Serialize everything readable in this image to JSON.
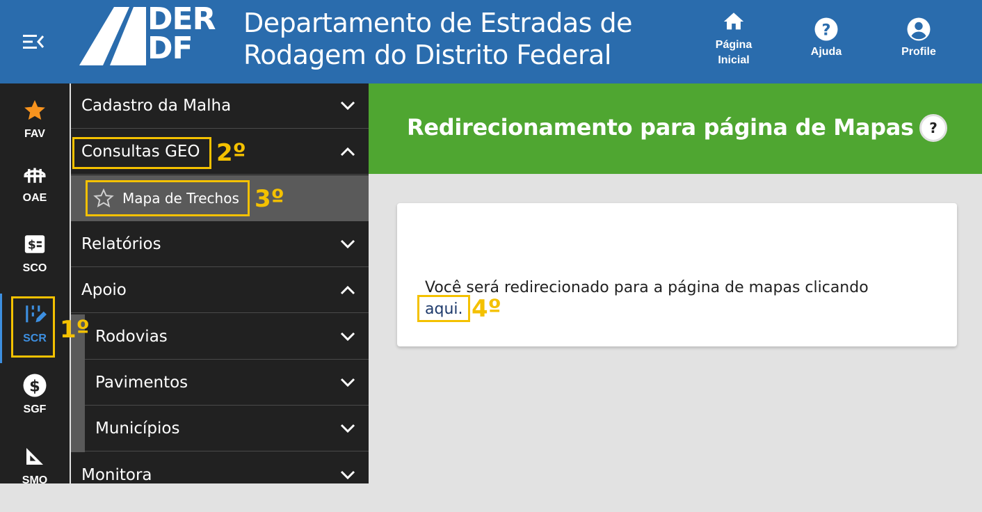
{
  "header": {
    "logo_line1": "DER",
    "logo_line2": "DF",
    "title_line1": "Departamento de Estradas de",
    "title_line2": "Rodagem do Distrito Federal",
    "nav": [
      {
        "label_line1": "Página",
        "label_line2": "Inicial",
        "icon": "home-icon"
      },
      {
        "label": "Ajuda",
        "icon": "help-circle-icon"
      },
      {
        "label": "Profile",
        "icon": "account-circle-icon"
      }
    ]
  },
  "rail": [
    {
      "label": "FAV",
      "icon": "star-icon"
    },
    {
      "label": "OAE",
      "icon": "bridge-icon"
    },
    {
      "label": "SCO",
      "icon": "money-card-icon"
    },
    {
      "label": "SCR",
      "icon": "road-edit-icon",
      "active": true
    },
    {
      "label": "SGF",
      "icon": "dollar-circle-icon"
    },
    {
      "label": "SMO",
      "icon": "set-square-icon"
    }
  ],
  "menu": {
    "items": [
      {
        "label": "Cadastro da Malha",
        "state": "collapsed"
      },
      {
        "label": "Consultas GEO",
        "state": "expanded"
      },
      {
        "label": "Mapa de Trechos",
        "state": "leaf"
      },
      {
        "label": "Relatórios",
        "state": "collapsed"
      },
      {
        "label": "Apoio",
        "state": "expanded"
      },
      {
        "label": "Rodovias",
        "state": "collapsed"
      },
      {
        "label": "Pavimentos",
        "state": "collapsed"
      },
      {
        "label": "Municípios",
        "state": "collapsed"
      },
      {
        "label": "Monitora",
        "state": "collapsed"
      }
    ]
  },
  "steps": {
    "s1": "1º",
    "s2": "2º",
    "s3": "3º",
    "s4": "4º"
  },
  "page": {
    "title": "Redirecionamento para página de Mapas",
    "help_label": "?",
    "message": "Você será redirecionado para a página de mapas clicando",
    "link_text": "aqui."
  },
  "colors": {
    "header_bg": "#2a6cad",
    "page_header_bg": "#4fa631",
    "highlight": "#f4c100",
    "active_rail": "#3d8fe0"
  }
}
